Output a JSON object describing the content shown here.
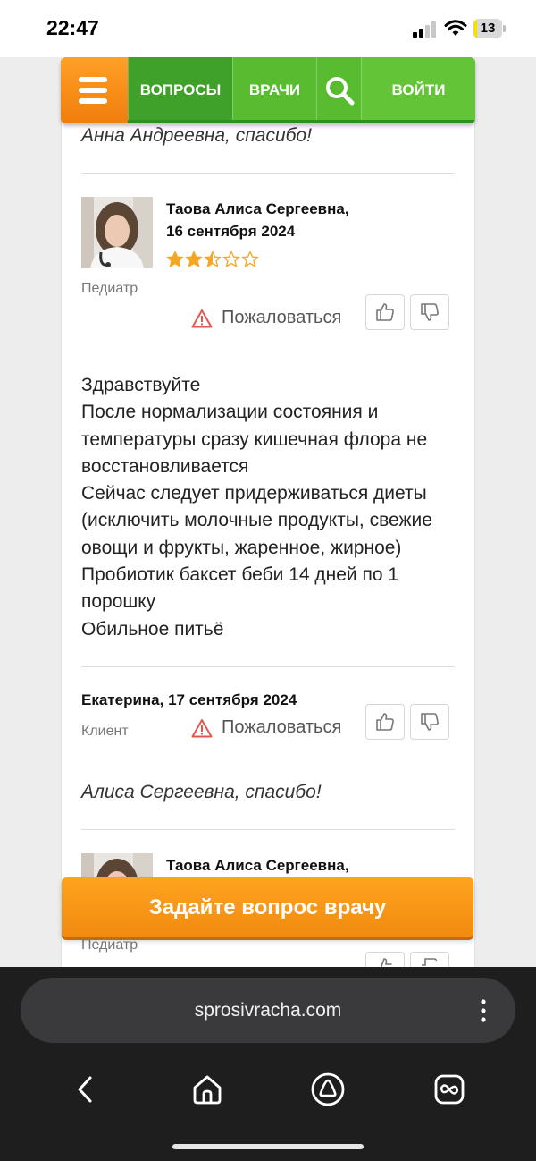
{
  "status_bar": {
    "time": "22:47",
    "battery": "13",
    "battery_level": 0.13
  },
  "nav": {
    "questions": "ВОПРОСЫ",
    "doctors": "ВРАЧИ",
    "login": "ВОЙТИ"
  },
  "thread": {
    "prev_message": "Анна Андреевна, спасибо!",
    "doctor_answer": {
      "author": "Таова Алиса Сергеевна,",
      "date": "16 сентября 2024",
      "rating": 2.5,
      "role": "Педиатр",
      "complain_label": "Пожаловаться",
      "text_lines": [
        "Здравствуйте",
        "После нормализации состояния и температуры сразу кишечная флора не восстановливается",
        "Сейчас следует придерживаться диеты (исключить молочные продукты, свежие овощи и фрукты, жаренное, жирное)",
        "Пробиотик баксет беби 14 дней по 1 порошку",
        "Обильное питьё"
      ]
    },
    "client_message": {
      "author_date": "Екатерина, 17 сентября 2024",
      "role": "Клиент",
      "complain_label": "Пожаловаться",
      "text": "Алиса Сергеевна, спасибо!"
    },
    "next_doctor": {
      "author": "Таова Алиса Сергеевна,",
      "role": "Педиатр"
    }
  },
  "cta_label": "Задайте вопрос врачу",
  "browser": {
    "url": "sprosivracha.com"
  },
  "colors": {
    "green": "#58bb30",
    "orange": "#f08a10",
    "star": "#f5a623"
  }
}
